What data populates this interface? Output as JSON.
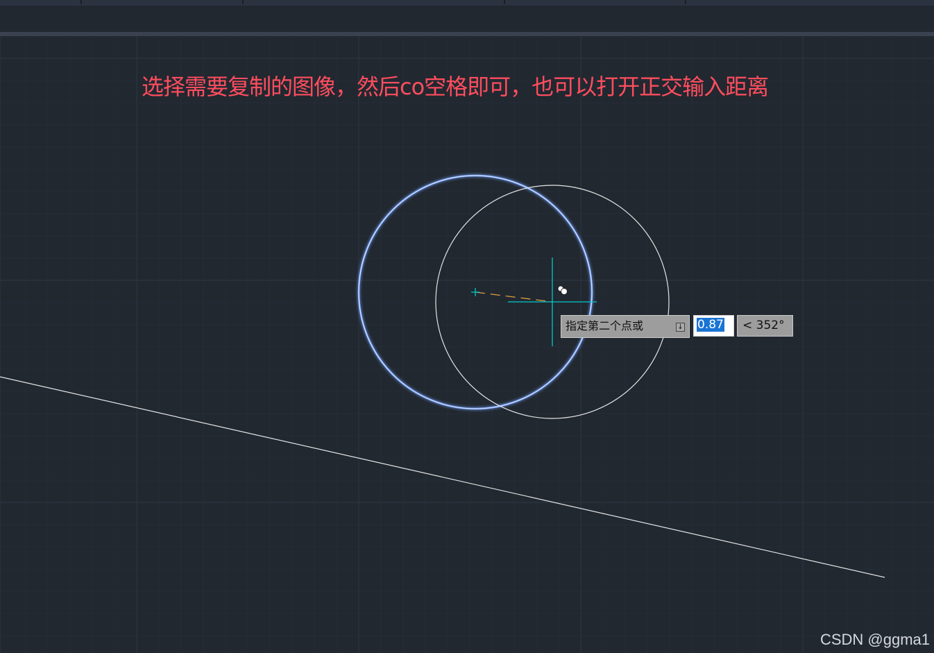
{
  "annotation": {
    "text": "选择需要复制的图像，然后co空格即可，也可以打开正交输入距离",
    "color": "#ff4d5e"
  },
  "dynamic_input": {
    "prompt_label": "指定第二个点或",
    "dropdown_icon": "down-arrow-icon",
    "distance_value": "0.87",
    "angle_value": "< 352°"
  },
  "watermark": "CSDN @ggma1",
  "colors": {
    "background": "#212830",
    "grid": "#2c3440",
    "selected_circle": "#7aa6ff",
    "copy_circle": "#e6e6e6",
    "crosshair": "#00c8c8",
    "rubberband": "#e0a040"
  }
}
